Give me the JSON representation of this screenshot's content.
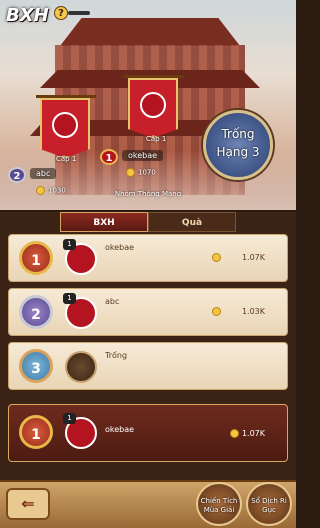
{
  "header": {
    "title": "BXH",
    "help_icon": "?"
  },
  "podium": {
    "first": {
      "level": "Cấp 1",
      "name": "okebae",
      "score": "1070"
    },
    "second": {
      "level": "Cấp 1",
      "name": "abc",
      "score": "1030"
    },
    "third_seal": {
      "line1": "Trống",
      "line2": "Hạng 3"
    }
  },
  "group_label": "Nhóm Thông Mạng",
  "tabs": [
    {
      "label": "BXH"
    },
    {
      "label": "Quà"
    }
  ],
  "rows": [
    {
      "rank": "1",
      "name": "okebae",
      "score": "1.07K",
      "badge": "1"
    },
    {
      "rank": "2",
      "name": "abc",
      "score": "1.03K",
      "badge": "1"
    },
    {
      "rank": "3",
      "name": "Trống",
      "score": ""
    }
  ],
  "my_row": {
    "rank": "1",
    "name": "okebae",
    "score": "1.07K",
    "badge": "1"
  },
  "bottom": {
    "back_icon": "⇐",
    "btn1": "Chiến Tích Mùa Giải",
    "btn2": "Sổ Dịch Ri Gục"
  },
  "colors": {
    "accent": "#c8202a",
    "gold": "#e8b84a"
  }
}
